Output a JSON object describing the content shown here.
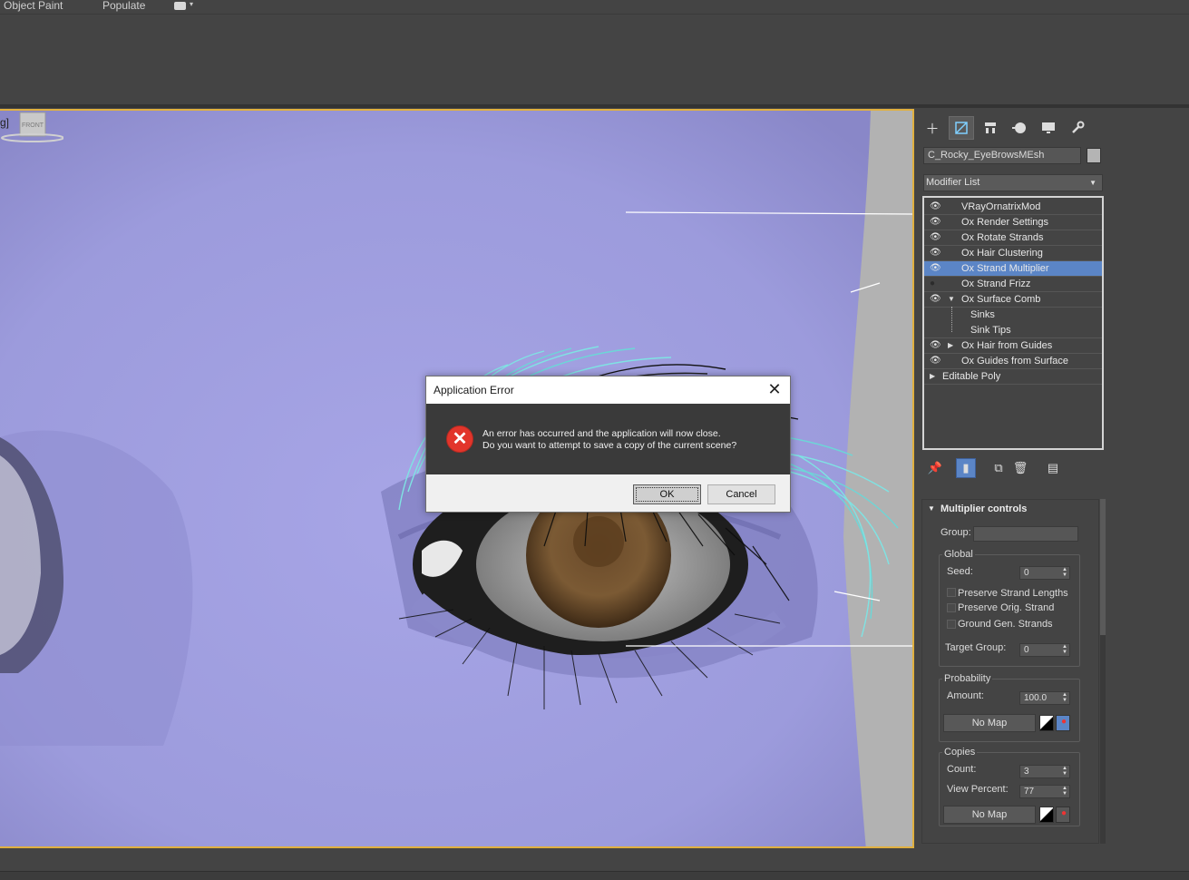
{
  "menubar": {
    "items": [
      "Object Paint",
      "Populate"
    ]
  },
  "viewport": {
    "label": "g]",
    "viewcube_label": "FRONT"
  },
  "panel": {
    "tabs": [
      "create-icon",
      "modify-icon",
      "hierarchy-icon",
      "motion-icon",
      "display-icon",
      "utilities-icon"
    ],
    "object_name": "C_Rocky_EyeBrowsMEsh",
    "object_color": "#b4b4b4",
    "modifier_list_label": "Modifier List",
    "stack": [
      {
        "label": "VRayOrnatrixMod",
        "visible": true
      },
      {
        "label": "Ox Render Settings",
        "visible": true
      },
      {
        "label": "Ox Rotate Strands",
        "visible": true
      },
      {
        "label": "Ox Hair Clustering",
        "visible": true
      },
      {
        "label": "Ox Strand Multiplier",
        "visible": true,
        "selected": true
      },
      {
        "label": "Ox Strand Frizz",
        "visible": false
      },
      {
        "label": "Ox Surface Comb",
        "visible": true,
        "expanded": true
      },
      {
        "label": "Sinks",
        "sub": true
      },
      {
        "label": "Sink Tips",
        "sub": true
      },
      {
        "label": "Ox Hair from Guides",
        "visible": true,
        "collapsed": true
      },
      {
        "label": "Ox Guides from Surface",
        "visible": true
      },
      {
        "label": "Editable Poly",
        "collapsed": true,
        "no_eye": true
      }
    ],
    "selection_color": "#5b85c6",
    "rollout": {
      "title": "Multiplier controls",
      "group_label": "Group:",
      "group_value": "",
      "global": {
        "title": "Global",
        "seed_label": "Seed:",
        "seed_value": "0",
        "preserve_lengths": "Preserve Strand Lengths",
        "preserve_orig": "Preserve Orig. Strand",
        "ground_gen": "Ground Gen. Strands",
        "target_group_label": "Target Group:",
        "target_group_value": "0"
      },
      "probability": {
        "title": "Probability",
        "amount_label": "Amount:",
        "amount_value": "100.0",
        "map_button": "No Map"
      },
      "copies": {
        "title": "Copies",
        "count_label": "Count:",
        "count_value": "3",
        "view_percent_label": "View Percent:",
        "view_percent_value": "77",
        "map_button": "No Map"
      }
    }
  },
  "dialog": {
    "title": "Application Error",
    "message_line1": "An error has occurred and the application will now close.",
    "message_line2": "Do you want to attempt to save a copy of the current scene?",
    "ok_label": "OK",
    "cancel_label": "Cancel",
    "icon": "error-icon",
    "icon_color": "#e2352b"
  }
}
